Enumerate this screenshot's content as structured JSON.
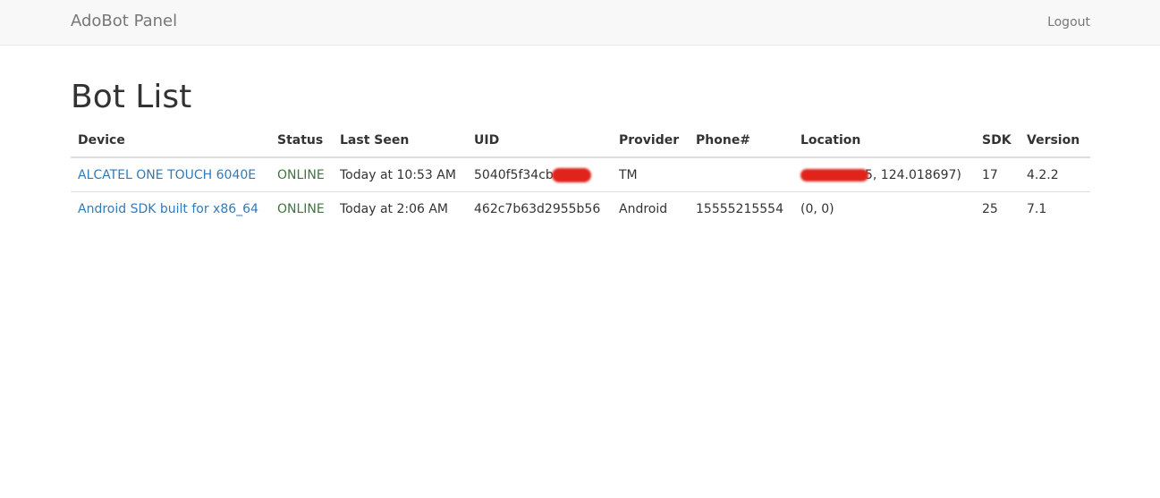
{
  "navbar": {
    "brand": "AdoBot Panel",
    "logout_label": "Logout"
  },
  "page": {
    "title": "Bot List"
  },
  "table": {
    "headers": [
      "Device",
      "Status",
      "Last Seen",
      "UID",
      "Provider",
      "Phone#",
      "Location",
      "SDK",
      "Version"
    ],
    "rows": [
      {
        "device": "ALCATEL ONE TOUCH 6040E",
        "status": "ONLINE",
        "last_seen": "Today at 10:53 AM",
        "uid_visible": "5040f5f34cb",
        "provider": "TM",
        "phone": "",
        "location_visible": "5, 124.018697)",
        "sdk": "17",
        "version": "4.2.2"
      },
      {
        "device": "Android SDK built for x86_64",
        "status": "ONLINE",
        "last_seen": "Today at 2:06 AM",
        "uid_visible": "462c7b63d2955b56",
        "provider": "Android",
        "phone": "15555215554",
        "location_visible": "(0, 0)",
        "sdk": "25",
        "version": "7.1"
      }
    ]
  },
  "colors": {
    "link": "#337ab7",
    "online": "#3c763d",
    "redaction": "#e0231b",
    "navbar_bg": "#f8f8f8"
  }
}
